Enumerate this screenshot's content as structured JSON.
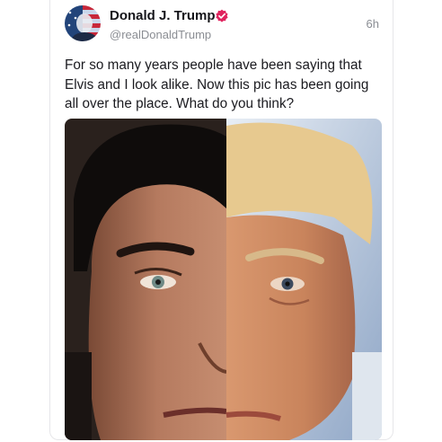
{
  "post": {
    "display_name": "Donald J. Trump",
    "handle": "@realDonaldTrump",
    "timestamp": "6h",
    "text": "For so many years people have been saying that Elvis and I look alike. Now this pic has been going all over the place. What do you think?",
    "verified": true,
    "avatar_icon": "american-flag-portrait-avatar",
    "media_description_icon": "split-face-photo"
  },
  "colors": {
    "verified_badge": "#e0245e",
    "name_text": "#15151a",
    "meta_text": "#8a8d93"
  }
}
